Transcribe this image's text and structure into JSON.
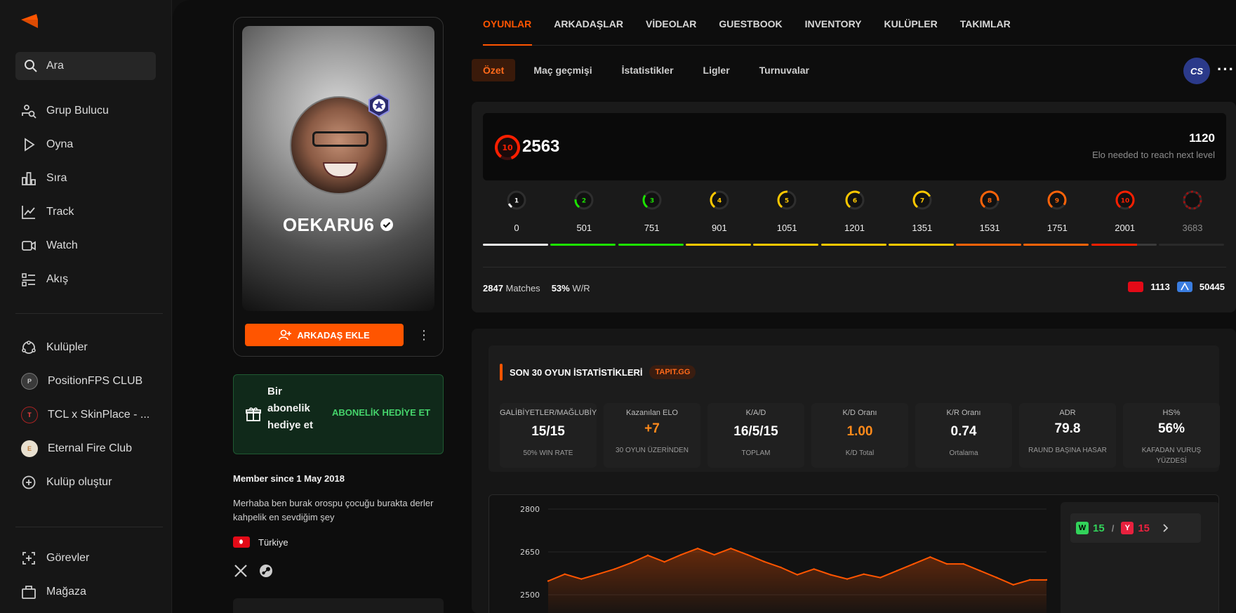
{
  "sidebar": {
    "search_label": "Ara",
    "nav": [
      {
        "label": "Grup Bulucu",
        "icon": "group-finder-icon"
      },
      {
        "label": "Oyna",
        "icon": "play-icon"
      },
      {
        "label": "Sıra",
        "icon": "ranking-icon"
      },
      {
        "label": "Track",
        "icon": "track-icon"
      },
      {
        "label": "Watch",
        "icon": "watch-icon"
      },
      {
        "label": "Akış",
        "icon": "feed-icon"
      }
    ],
    "clubs": [
      {
        "label": "Kulüpler"
      },
      {
        "label": "PositionFPS CLUB"
      },
      {
        "label": "TCL x SkinPlace - ..."
      },
      {
        "label": "Eternal Fire Club"
      },
      {
        "label": "Kulüp oluştur"
      }
    ],
    "bottom": [
      {
        "label": "Görevler"
      },
      {
        "label": "Mağaza"
      }
    ]
  },
  "profile": {
    "username": "OEKARU6",
    "add_friend_label": "ARKADAŞ EKLE",
    "gift_text": "Bir abonelik hediye et",
    "gift_cta": "ABONELİK HEDİYE ET",
    "member_since": "Member since 1 May 2018",
    "bio": "Merhaba ben burak orospu çocuğu burakta derler kahpelik en sevdiğim şey",
    "country": "Türkiye"
  },
  "tabs": [
    "OYUNLAR",
    "ARKADAŞLAR",
    "VİDEOLAR",
    "GUESTBOOK",
    "INVENTORY",
    "KULÜPLER",
    "TAKIMLAR"
  ],
  "subtabs": [
    "Özet",
    "Maç geçmişi",
    "İstatistikler",
    "Ligler",
    "Turnuvalar"
  ],
  "game_icon_label": "CS",
  "elo": {
    "level": "10",
    "value": "2563",
    "next_value": "1120",
    "next_label": "Elo needed to reach next level",
    "levels": [
      {
        "level": "1",
        "threshold": "0",
        "color": "#eeeeee"
      },
      {
        "level": "2",
        "threshold": "501",
        "color": "#1ce400"
      },
      {
        "level": "3",
        "threshold": "751",
        "color": "#1ce400"
      },
      {
        "level": "4",
        "threshold": "901",
        "color": "#ffc800"
      },
      {
        "level": "5",
        "threshold": "1051",
        "color": "#ffc800"
      },
      {
        "level": "6",
        "threshold": "1201",
        "color": "#ffc800"
      },
      {
        "level": "7",
        "threshold": "1351",
        "color": "#ffc800"
      },
      {
        "level": "8",
        "threshold": "1531",
        "color": "#ff6309"
      },
      {
        "level": "9",
        "threshold": "1751",
        "color": "#ff6309"
      },
      {
        "level": "10",
        "threshold": "2001",
        "color": "#fe1f00"
      },
      {
        "level": "",
        "threshold": "3683",
        "color": "#a01010"
      }
    ],
    "matches": "2847",
    "matches_label": "Matches",
    "winrate": "53%",
    "winrate_label": "W/R",
    "country_rank": "1113",
    "region_rank": "50445"
  },
  "stats": {
    "title": "SON 30 OYUN İSTATİSTİKLERİ",
    "tag": "TAPIT.GG",
    "cells": [
      {
        "label": "GALİBİYETLER/MAĞLUBİYETLER",
        "value": "15/15",
        "sub": "50% WIN RATE"
      },
      {
        "label": "Kazanılan ELO",
        "value": "+7",
        "sub": "30 OYUN ÜZERİNDEN"
      },
      {
        "label": "K/A/D",
        "value": "16/5/15",
        "sub": "TOPLAM"
      },
      {
        "label": "K/D Oranı",
        "value": "1.00",
        "sub": "K/D Total"
      },
      {
        "label": "K/R Oranı",
        "value": "0.74",
        "sub": "Ortalama"
      },
      {
        "label": "ADR",
        "value": "79.8",
        "sub": "RAUND BAŞINA HASAR"
      },
      {
        "label": "HS%",
        "value": "56%",
        "sub": "KAFADAN VURUŞ YÜZDESİ"
      }
    ],
    "accent_color": "#ff8a1a"
  },
  "chart_data": {
    "type": "area",
    "x": [
      1,
      2,
      3,
      4,
      5,
      6,
      7,
      8,
      9,
      10,
      11,
      12,
      13,
      14,
      15,
      16,
      17,
      18,
      19,
      20,
      21,
      22,
      23,
      24,
      25,
      26,
      27,
      28,
      29,
      30,
      31
    ],
    "values": [
      2548,
      2572,
      2555,
      2572,
      2590,
      2612,
      2638,
      2615,
      2640,
      2662,
      2640,
      2662,
      2640,
      2616,
      2596,
      2570,
      2590,
      2570,
      2555,
      2572,
      2560,
      2584,
      2608,
      2632,
      2608,
      2608,
      2584,
      2560,
      2535,
      2552,
      2552
    ],
    "yticks": [
      "2800",
      "2650",
      "2500"
    ],
    "ylim": [
      2480,
      2830
    ],
    "line_color": "#ff5500"
  },
  "wl": {
    "w_label": "W",
    "w_value": "15",
    "sep": "/",
    "l_label": "Y",
    "l_value": "15"
  }
}
